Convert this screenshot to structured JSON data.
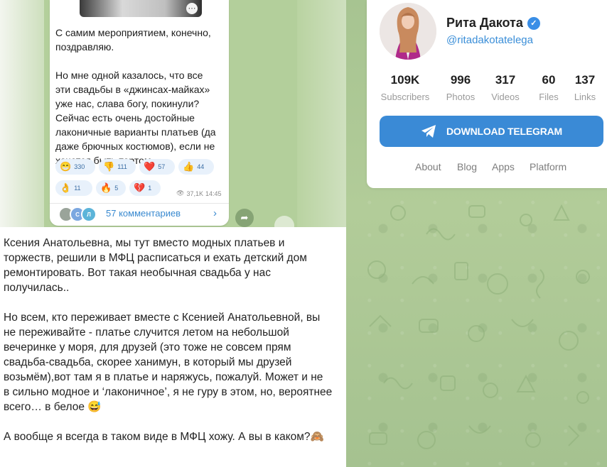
{
  "shot": {
    "message_text": "С самим мероприятием, конечно,\nпоздравляю.\n\nНо мне одной казалось, что все\nэти свадьбы в «джинсах-майках»\nуже нас, слава богу, покинули?\nСейчас есть очень достойные\nлаконичные варианты платьев (да\nдаже брючных костюмов), если не\nхочется быть тортом",
    "reactions": [
      {
        "emoji": "😁",
        "count": "330"
      },
      {
        "emoji": "👎",
        "count": "111"
      },
      {
        "emoji": "❤️",
        "count": "57"
      },
      {
        "emoji": "👍",
        "count": "44"
      },
      {
        "emoji": "👌",
        "count": "11"
      },
      {
        "emoji": "🔥",
        "count": "5"
      },
      {
        "emoji": "💔",
        "count": "1"
      }
    ],
    "views": "37,1K",
    "time": "14:45",
    "comments_label": "57 комментариев",
    "avatar_letters": [
      "С",
      "Л"
    ]
  },
  "post": {
    "text": "Ксения Анатольевна, мы тут вместо модных платьев и\nторжеств, решили в МФЦ расписаться и ехать детский дом\nремонтировать. Вот такая необычная свадьба у нас\nполучилась..\n\nНо всем, кто переживает вместе с Ксенией Анатольевной, вы\nне переживайте - платье случится летом на небольшой\nвечеринке у моря, для друзей (это тоже не совсем прям\nсвадьба-свадьба, скорее ханимун, в который мы друзей\nвозьмём),вот там я в платье и наряжусь, пожалуй. Может и не\nв сильно модное и ‘лаконичное’, я не гуру в этом, но, вероятнее\nвсего… в белое 😅\n\nА вообще я всегда в таком виде в МФЦ хожу. А вы в каком?🙈"
  },
  "profile": {
    "name": "Рита Дакота",
    "handle": "@ritadakotatelega",
    "stats": [
      {
        "value": "109K",
        "label": "Subscribers"
      },
      {
        "value": "996",
        "label": "Photos"
      },
      {
        "value": "317",
        "label": "Videos"
      },
      {
        "value": "60",
        "label": "Files"
      },
      {
        "value": "137",
        "label": "Links"
      }
    ],
    "download_label": "DOWNLOAD TELEGRAM",
    "footer_links": [
      "About",
      "Blog",
      "Apps",
      "Platform"
    ]
  },
  "colors": {
    "accent": "#3a8ad6",
    "wallpaper": "#a9c695",
    "verified": "#3a8ee6"
  },
  "icons": [
    "more-dots-icon",
    "eye-icon",
    "chevron-right-icon",
    "share-icon",
    "verified-icon",
    "telegram-plane-icon"
  ]
}
